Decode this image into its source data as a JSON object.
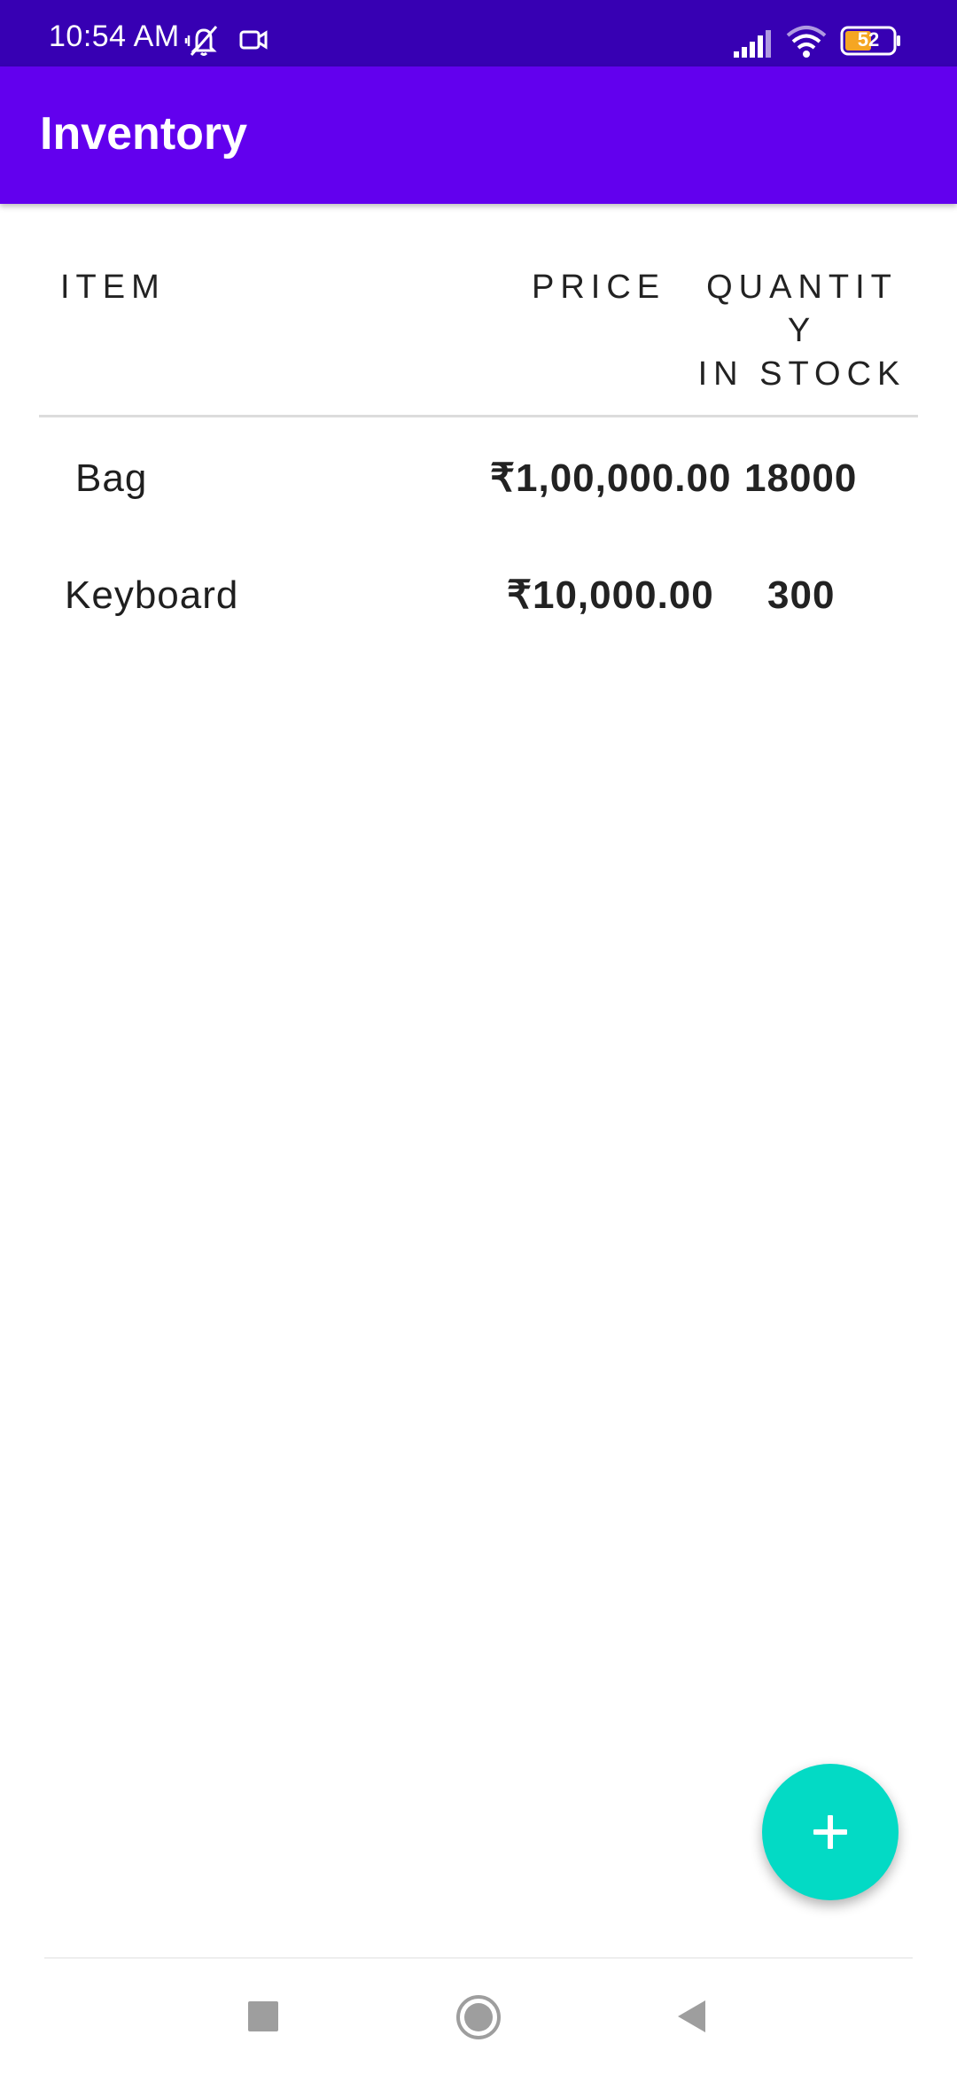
{
  "status_bar": {
    "time": "10:54 AM",
    "battery": "52",
    "background_color": "#3700b3",
    "icons": [
      "vibrate-off-icon",
      "camera-icon",
      "signal-icon",
      "wifi-icon",
      "battery-icon"
    ]
  },
  "app_bar": {
    "title": "Inventory",
    "background_color": "#6200ee"
  },
  "table": {
    "headers": {
      "item": "ITEM",
      "price": "PRICE",
      "quantity": "QUANTIT\nY\nIN STOCK"
    },
    "rows": [
      {
        "item": "Bag",
        "price": "₹1,00,000.00",
        "quantity": "18000"
      },
      {
        "item": "Keyboard",
        "price": "₹10,000.00",
        "quantity": "300"
      }
    ]
  },
  "fab": {
    "icon": "plus-icon",
    "color": "#03dac5"
  },
  "nav_bar": {
    "buttons": [
      "recents-square-icon",
      "home-circle-icon",
      "back-triangle-icon"
    ]
  }
}
